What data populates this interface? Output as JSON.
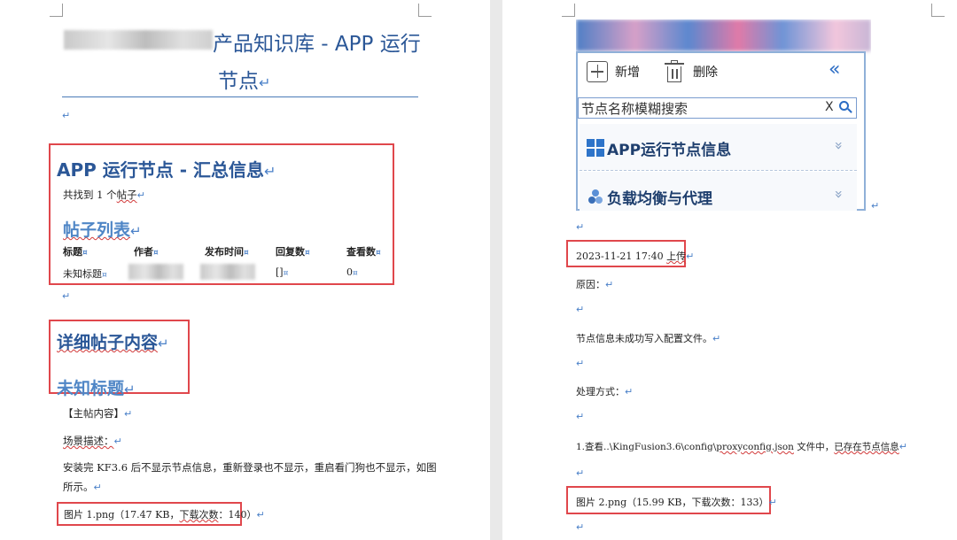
{
  "left_page": {
    "title_blurred_prefix": "",
    "title_line1": "产品知识库 - APP 运行",
    "title_line2": "节点",
    "para_mark": "↵",
    "section1_heading": "APP 运行节点 - 汇总信息",
    "found_text_1": "共找到",
    "found_text_2": "1",
    "found_text_3": "个",
    "found_text_4": "帖子",
    "post_list_heading": "帖子列表",
    "table": {
      "headers": [
        "标题",
        "作者",
        "发布时间",
        "回复数",
        "查看数"
      ],
      "row": {
        "title": "未知标题",
        "author": "",
        "time": "",
        "replies": "[]",
        "views": "0"
      }
    },
    "detail_heading": "详细帖子内容",
    "unknown_title": "未知标题",
    "main_post_label": "【主帖内容】",
    "scene_label": "场景描述：",
    "desc_line1": "安装完 KF3.6 后不显示节点信息，重新登录也不显示，重启看门狗也不显示，如图",
    "desc_line2": "所示。",
    "image_note_a": "图片 1.png（17.47 KB，",
    "image_note_b": "下载次数",
    "image_note_c": "：140）"
  },
  "right_page": {
    "ui": {
      "add_label": "新增",
      "delete_label": "删除",
      "collapse_icon": "«",
      "search_placeholder": "节点名称模糊搜索",
      "clear_label": "X",
      "row1_label": "APP运行节点信息",
      "row2_label": "负载均衡与代理",
      "expand_icon": "»"
    },
    "upload_a": "2023-11-21 17:40 ",
    "upload_b": "上传",
    "reason_label": "原因：",
    "reason_text": "节点信息未成功写入配置文件。",
    "method_label": "处理方式：",
    "step_a": "1.查看..\\KingFusion3.6\\config\\",
    "step_b": "proxyconfig.json",
    "step_c": " 文件中，",
    "step_d": "已存在节点信息",
    "image_note": "图片 2.png（15.99 KB，下载次数：133）"
  },
  "colors": {
    "heading": "#2b5797",
    "heading_light": "#4f86c6",
    "red_box": "#e0474c",
    "para_mark": "#4a80c8"
  }
}
